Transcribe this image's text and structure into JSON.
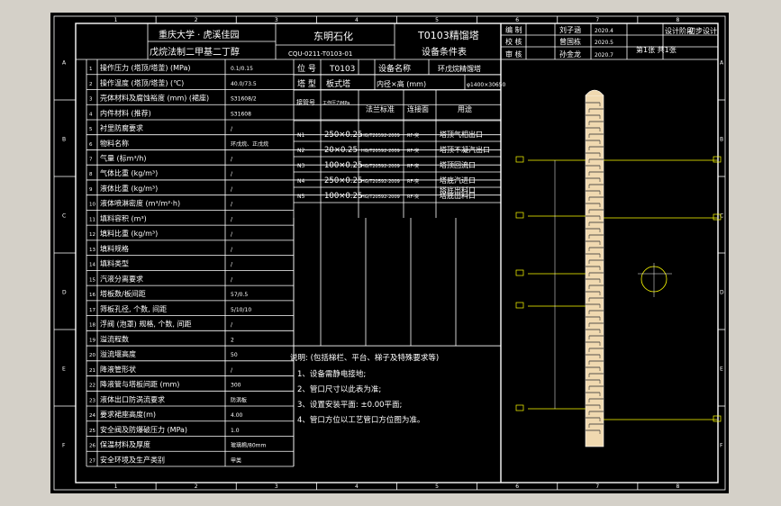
{
  "title_block": {
    "university": "重庆大学 · 虎溪佳园",
    "project": "戊烷法制二甲基二丁醇",
    "company": "东明石化",
    "doc_code": "CQU-0211-T0103-01",
    "drawing_title_1": "T0103精馏塔",
    "drawing_title_2": "设备条件表"
  },
  "signoff": [
    {
      "role": "编 制",
      "name": "刘子涵",
      "date": "2020.4"
    },
    {
      "role": "校 核",
      "name": "曾国栋",
      "date": "2020.5"
    },
    {
      "role": "审 核",
      "name": "孙金龙",
      "date": "2020.7"
    }
  ],
  "stage": {
    "label": "设计阶段",
    "value": "初步设计",
    "sheet": "第1张  共1张"
  },
  "grid_numbers": [
    "1",
    "2",
    "3",
    "4",
    "5",
    "6",
    "7",
    "8"
  ],
  "grid_letters": [
    "A",
    "B",
    "C",
    "D",
    "E",
    "F"
  ],
  "params": [
    {
      "no": "1",
      "name": "操作压力 (塔顶/塔釜) (MPa)",
      "value": "0.1/0.15"
    },
    {
      "no": "2",
      "name": "操作温度 (塔顶/塔釜) (℃)",
      "value": "40.0/73.5"
    },
    {
      "no": "3",
      "name": "壳体材料及腐蚀裕度 (mm) (裙座)",
      "value": "S31608/2"
    },
    {
      "no": "4",
      "name": "内件材料 (推荐)",
      "value": "S31608"
    },
    {
      "no": "5",
      "name": "衬里防腐要求",
      "value": "/"
    },
    {
      "no": "6",
      "name": "物料名称",
      "value": "环戊烷、正戊烷"
    },
    {
      "no": "7",
      "name": "气量 (标m³/h)",
      "value": "/"
    },
    {
      "no": "8",
      "name": "气体比重 (kg/m³)",
      "value": "/"
    },
    {
      "no": "9",
      "name": "液体比重 (kg/m³)",
      "value": "/"
    },
    {
      "no": "10",
      "name": "液体喷淋密度 (m³/m²·h)",
      "value": "/"
    },
    {
      "no": "11",
      "name": "填料容积 (m³)",
      "value": "/"
    },
    {
      "no": "12",
      "name": "填料比重 (kg/m³)",
      "value": "/"
    },
    {
      "no": "13",
      "name": "填料规格",
      "value": "/"
    },
    {
      "no": "14",
      "name": "填料类型",
      "value": "/"
    },
    {
      "no": "15",
      "name": "汽液分离要求",
      "value": "/"
    },
    {
      "no": "16",
      "name": "塔板数/板间距",
      "value": "57/0.5"
    },
    {
      "no": "17",
      "name": "筛板孔径, 个数, 间距",
      "value": "5/10/10"
    },
    {
      "no": "18",
      "name": "浮阀 (泡罩) 规格, 个数, 间距",
      "value": "/"
    },
    {
      "no": "19",
      "name": "溢流程数",
      "value": "2"
    },
    {
      "no": "20",
      "name": "溢流堰高度",
      "value": "50"
    },
    {
      "no": "21",
      "name": "降液管形状",
      "value": "/"
    },
    {
      "no": "22",
      "name": "降液管与塔板间距 (mm)",
      "value": "300"
    },
    {
      "no": "23",
      "name": "液体出口防涡流要求",
      "value": "防涡板"
    },
    {
      "no": "24",
      "name": "要求裙座高度(m)",
      "value": "4.00"
    },
    {
      "no": "25",
      "name": "安全阀及防爆破压力 (MPa)",
      "value": "1.0"
    },
    {
      "no": "26",
      "name": "保温材料及厚度",
      "value": "玻璃棉/80mm"
    },
    {
      "no": "27",
      "name": "安全环境及生产类别",
      "value": "甲类"
    }
  ],
  "equipment": {
    "tag_label": "位 号",
    "tag": "T0103",
    "name_label": "设备名称",
    "name": "环戊烷精馏塔",
    "type_label": "塔 型",
    "type": "板式塔",
    "diameter_label": "内径×高 (mm)",
    "diameter": "φ1400×30650"
  },
  "nozzle_headers": {
    "mark": "接管号",
    "pressure": "工作压力MPa",
    "standard": "法兰标准",
    "face": "连接面",
    "purpose": "用途"
  },
  "nozzles": [
    {
      "mark": "N1",
      "size": "250×0.25",
      "std": "HG/T20592-2009",
      "face": "RF-突",
      "purpose": "塔顶气相出口"
    },
    {
      "mark": "N2",
      "size": "20×0.25",
      "std": "HG/T20592-2009",
      "face": "RF-突",
      "purpose": "塔顶不凝汽出口"
    },
    {
      "mark": "N3",
      "size": "100×0.25",
      "std": "HG/T20592-2009",
      "face": "RF-突",
      "purpose": "塔顶回流口"
    },
    {
      "mark": "N4",
      "size": "250×0.25",
      "std": "HG/T20592-2009",
      "face": "RF-突",
      "purpose": "塔底汽进口"
    },
    {
      "mark": "N5",
      "size": "100×0.25",
      "std": "HG/T20592-2009",
      "face": "RF-突",
      "purpose": "塔底出料口"
    }
  ],
  "nozzle_extra": "塔底出料口",
  "notes": [
    "说明: (包括梯栏、平台、梯子及特殊要求等)",
    "1、设备需静电接地;",
    "2、管口尺寸以此表为准;",
    "3、设置安装平面: ±0.00平面;",
    "4、管口方位以工艺管口方位图为准。"
  ],
  "colors": {
    "drawing_line": "#ffffff",
    "tower_fill": "#f0d9b0",
    "leader": "#ffff00",
    "label_box": "#ffff00"
  }
}
